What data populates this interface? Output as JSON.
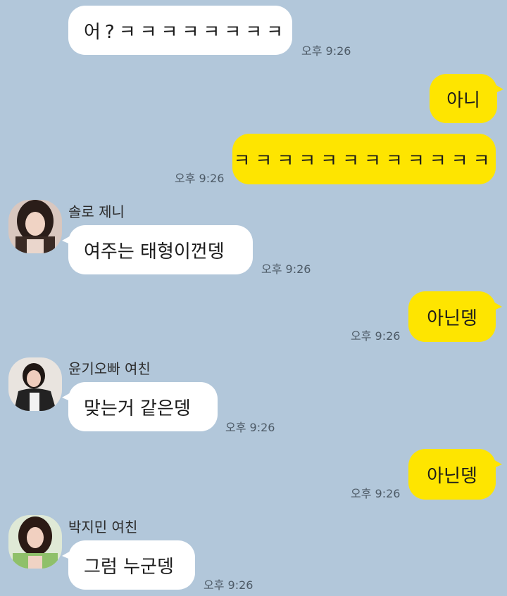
{
  "messages": [
    {
      "side": "in",
      "text": "어?ㅋㅋㅋㅋㅋㅋㅋㅋ",
      "time": "오후 9:26"
    },
    {
      "side": "out",
      "text": "아니",
      "time": ""
    },
    {
      "side": "out",
      "text": "ㅋㅋㅋㅋㅋㅋㅋㅋㅋㅋㅋㅋ",
      "time": "오후 9:26"
    },
    {
      "side": "in",
      "sender": "솔로 제니",
      "text": "여주는 태형이껀뎅",
      "time": "오후 9:26"
    },
    {
      "side": "out",
      "text": "아닌뎅",
      "time": "오후 9:26"
    },
    {
      "side": "in",
      "sender": "윤기오빠 여친",
      "text": "맞는거 같은뎅",
      "time": "오후 9:26"
    },
    {
      "side": "out",
      "text": "아닌뎅",
      "time": "오후 9:26"
    },
    {
      "side": "in",
      "sender": "박지민 여친",
      "text": "그럼 누군뎅",
      "time": "오후 9:26"
    }
  ],
  "colors": {
    "background": "#b2c7da",
    "sent_bubble": "#fee500",
    "received_bubble": "#ffffff"
  }
}
